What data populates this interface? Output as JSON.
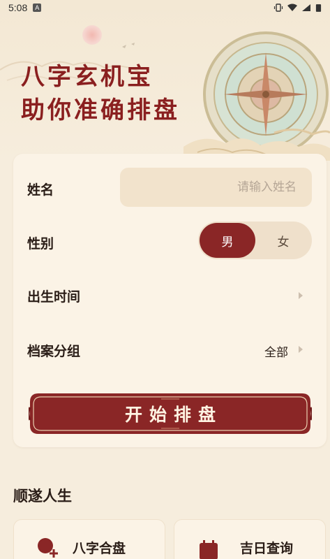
{
  "status_bar": {
    "time": "5:08",
    "notification_badge": "A",
    "icons": [
      "vibrate-icon",
      "wifi-icon",
      "signal-icon",
      "battery-icon"
    ]
  },
  "hero": {
    "title_line1": "八字玄机宝",
    "title_line2": "助你准确排盘"
  },
  "form": {
    "name_label": "姓名",
    "name_placeholder": "请输入姓名",
    "name_value": "",
    "gender_label": "性别",
    "gender_options": [
      "男",
      "女"
    ],
    "gender_selected": "男",
    "birth_label": "出生时间",
    "birth_value": "",
    "group_label": "档案分组",
    "group_value": "全部",
    "submit_label": "开始排盘"
  },
  "section": {
    "title": "顺遂人生",
    "features": [
      {
        "label": "八字合盘",
        "icon": "couple-icon"
      },
      {
        "label": "吉日查询",
        "icon": "calendar-icon"
      }
    ]
  },
  "colors": {
    "accent": "#8a2626",
    "background": "#f6eddd",
    "card": "#fbf3e6",
    "input": "#f2e3cc"
  }
}
